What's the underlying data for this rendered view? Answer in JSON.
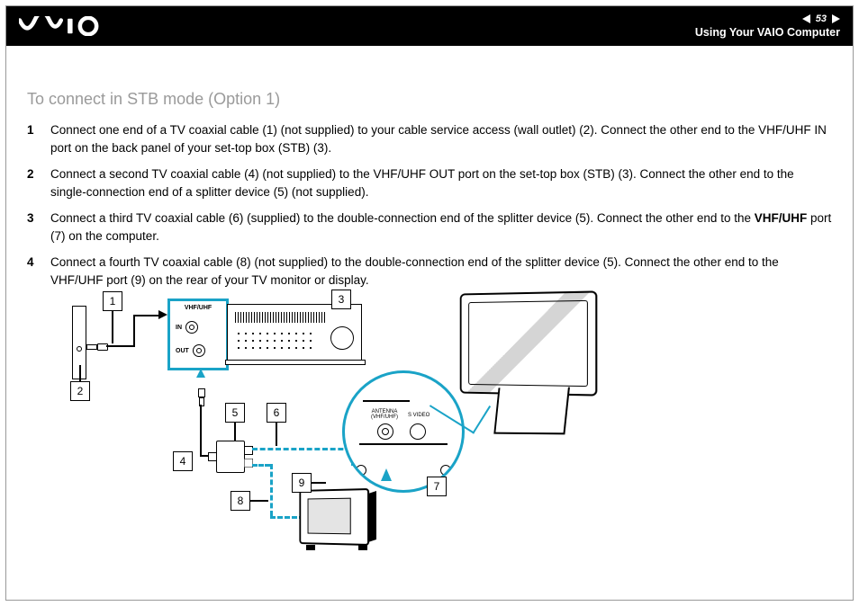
{
  "header": {
    "page_number": "53",
    "section": "Using Your VAIO Computer"
  },
  "title": "To connect in STB mode (Option 1)",
  "steps": [
    {
      "n": "1",
      "text": "Connect one end of a TV coaxial cable (1) (not supplied) to your cable service access (wall outlet) (2). Connect the other end to the VHF/UHF IN port on the back panel of your set-top box (STB) (3)."
    },
    {
      "n": "2",
      "text": "Connect a second TV coaxial cable (4) (not supplied) to the VHF/UHF OUT port on the set-top box (STB) (3). Connect the other end to the single-connection end of a splitter device (5) (not supplied)."
    },
    {
      "n": "3",
      "html": "Connect a third TV coaxial cable (6) (supplied) to the double-connection end of the splitter device (5). Connect the other end to the <b>VHF/UHF</b> port (7) on the computer."
    },
    {
      "n": "4",
      "text": "Connect a fourth TV coaxial cable (8) (not supplied) to the double-connection end of the splitter device (5). Connect the other end to the VHF/UHF port (9) on the rear of your TV monitor or display."
    }
  ],
  "diagram": {
    "stb_panel_label": "VHF/UHF",
    "stb_in": "IN",
    "stb_out": "OUT",
    "detail_antenna": "ANTENNA (VHF/UHF)",
    "detail_svideo": "S VIDEO",
    "callouts": {
      "c1": "1",
      "c2": "2",
      "c3": "3",
      "c4": "4",
      "c5": "5",
      "c6": "6",
      "c7": "7",
      "c8": "8",
      "c9": "9"
    }
  }
}
